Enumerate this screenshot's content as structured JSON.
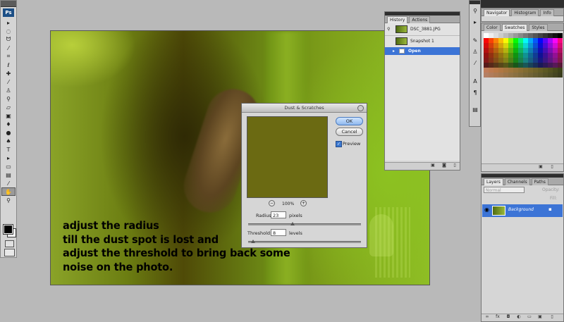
{
  "toolbar": {
    "app_badge": "Ps",
    "tools": [
      {
        "icon": "move-icon",
        "glyph": "▸"
      },
      {
        "icon": "marquee-icon",
        "glyph": "◌"
      },
      {
        "icon": "lasso-icon",
        "glyph": "ᗢ"
      },
      {
        "icon": "magic-wand-icon",
        "glyph": "⁄"
      },
      {
        "icon": "crop-icon",
        "glyph": "⌗"
      },
      {
        "icon": "eyedropper-icon",
        "glyph": "ℓ"
      },
      {
        "icon": "healing-brush-icon",
        "glyph": "✚"
      },
      {
        "icon": "brush-icon",
        "glyph": "⁄"
      },
      {
        "icon": "clone-stamp-icon",
        "glyph": "♙"
      },
      {
        "icon": "history-brush-icon",
        "glyph": "⚲"
      },
      {
        "icon": "eraser-icon",
        "glyph": "▱"
      },
      {
        "icon": "gradient-icon",
        "glyph": "▣"
      },
      {
        "icon": "blur-icon",
        "glyph": "♦"
      },
      {
        "icon": "dodge-icon",
        "glyph": "●"
      },
      {
        "icon": "pen-icon",
        "glyph": "♠"
      },
      {
        "icon": "type-icon",
        "glyph": "T"
      },
      {
        "icon": "path-select-icon",
        "glyph": "▸"
      },
      {
        "icon": "shape-icon",
        "glyph": "▭"
      },
      {
        "icon": "notes-icon",
        "glyph": "▤"
      },
      {
        "icon": "eyedropper2-icon",
        "glyph": "⁄"
      },
      {
        "icon": "hand-icon",
        "glyph": "✋"
      },
      {
        "icon": "zoom-icon",
        "glyph": "⚲"
      }
    ]
  },
  "document": {
    "instruction_lines": [
      "adjust the radius",
      "till the dust spot is lost and",
      "adjust the threshold to bring back some",
      "noise on the photo."
    ]
  },
  "dialog": {
    "title": "Dust & Scratches",
    "ok_label": "OK",
    "cancel_label": "Cancel",
    "preview_label": "Preview",
    "preview_checked": true,
    "zoom_level": "100%",
    "zoom_out": "−",
    "zoom_in": "+",
    "radius_label": "Radius:",
    "radius_value": "23",
    "radius_unit": "pixels",
    "threshold_label": "Threshold:",
    "threshold_value": "8",
    "threshold_unit": "levels"
  },
  "history_panel": {
    "tabs": [
      "History",
      "Actions"
    ],
    "items": [
      {
        "label": "DSC_3881.JPG",
        "type": "snapshot"
      },
      {
        "label": "Snapshot 1",
        "type": "snapshot"
      },
      {
        "label": "Open",
        "type": "state",
        "selected": true
      }
    ]
  },
  "navigator_panel": {
    "tabs": [
      "Navigator",
      "Histogram",
      "Info"
    ]
  },
  "swatches_panel": {
    "tabs": [
      "Color",
      "Swatches",
      "Styles"
    ]
  },
  "layers_panel": {
    "tabs": [
      "Layers",
      "Channels",
      "Paths"
    ],
    "blend_mode": "Normal",
    "opacity_label": "Opacity:",
    "fill_label": "Fill:",
    "layers": [
      {
        "name": "Background",
        "visible": true,
        "locked": true,
        "selected": true
      }
    ]
  },
  "colors": {
    "selection_blue": "#3c74d6",
    "dialog_gray": "#d6d6d6",
    "workspace_gray": "#b9b9b9"
  }
}
